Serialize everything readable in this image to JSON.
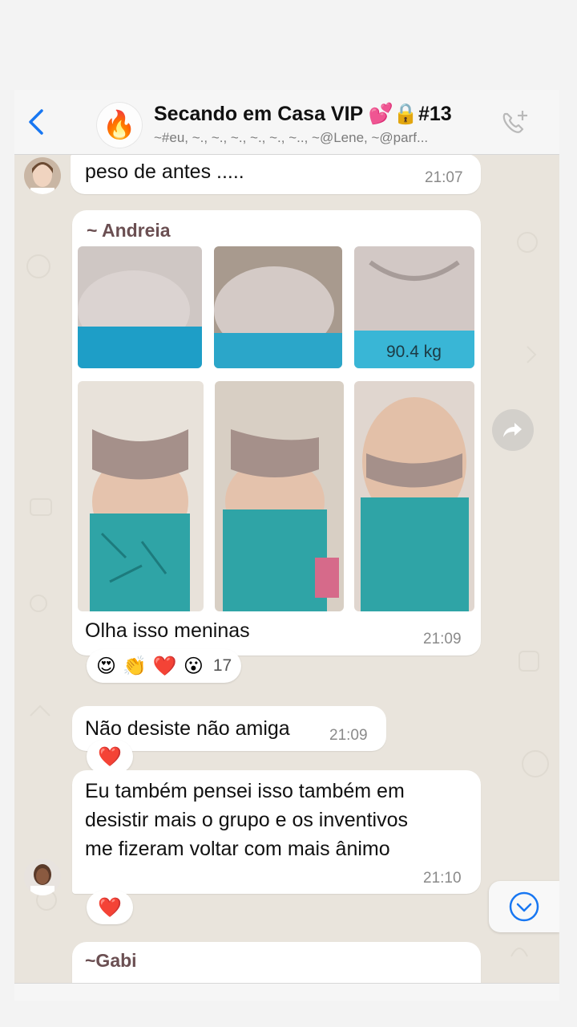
{
  "header": {
    "title": "Secando em Casa VIP 💕🔒#13",
    "subtitle": "~#eu, ~., ~., ~., ~., ~., ~.., ~@Lene, ~@parf...",
    "avatar_emoji": "🔥"
  },
  "messages": {
    "m1": {
      "text": "peso de antes .....",
      "time": "21:07"
    },
    "m2": {
      "sender": "~ Andreia",
      "photo_caption": "90.4 kg",
      "text": "Olha isso meninas",
      "time": "21:09",
      "reactions": [
        "😍",
        "👏",
        "❤️",
        "😮"
      ],
      "reaction_count": "17"
    },
    "m3": {
      "text": "Não desiste não amiga",
      "time": "21:09",
      "reaction": "❤️"
    },
    "m4": {
      "line1": "Eu também pensei isso também em",
      "line2": "desistir mais o grupo e os inventivos",
      "line3": "me fizeram voltar com mais ânimo",
      "time": "21:10",
      "reaction": "❤️"
    },
    "m5": {
      "sender": "~Gabi"
    }
  },
  "colors": {
    "accent_blue": "#1877f2",
    "chat_bg": "#e9e4dc",
    "bubble": "#ffffff",
    "sender_name": "#6b4f52"
  }
}
